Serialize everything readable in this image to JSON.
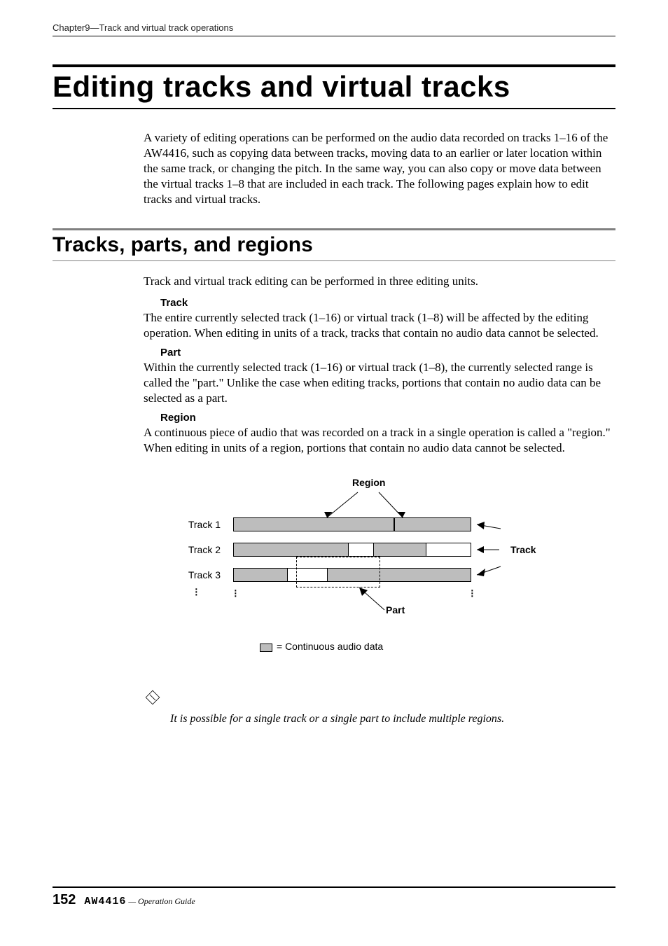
{
  "running_head": "Chapter9—Track and virtual track operations",
  "h1": "Editing tracks and virtual tracks",
  "intro": "A variety of editing operations can be performed on the audio data recorded on tracks 1–16 of the AW4416, such as copying data between tracks, moving data to an earlier or later location within the same track, or changing the pitch. In the same way, you can also copy or move data between the virtual tracks 1–8 that are included in each track. The following pages explain how to edit tracks and virtual tracks.",
  "h2": "Tracks, parts, and regions",
  "lead": "Track and virtual track editing can be performed in three editing units.",
  "terms": {
    "track_head": "Track",
    "track_body": "The entire currently selected track (1–16) or virtual track (1–8) will be affected by the editing operation. When editing in units of a track, tracks that contain no audio data cannot be selected.",
    "part_head": "Part",
    "part_body": "Within the currently selected track (1–16) or virtual track (1–8), the currently selected range is called the \"part.\" Unlike the case when editing tracks, portions that contain no audio data can be selected as a part.",
    "region_head": "Region",
    "region_body": "A continuous piece of audio that was recorded on a track in a single operation is called a \"region.\" When editing in units of a region, portions that contain no audio data cannot be selected."
  },
  "diagram": {
    "region_label": "Region",
    "track_label": "Track",
    "part_label": "Part",
    "track1": "Track 1",
    "track2": "Track 2",
    "track3": "Track 3",
    "legend": "= Continuous audio data"
  },
  "note": "It is possible for a single track or a single part to include multiple regions.",
  "footer": {
    "page": "152",
    "model": "AW4416",
    "suffix": " — Operation Guide"
  }
}
